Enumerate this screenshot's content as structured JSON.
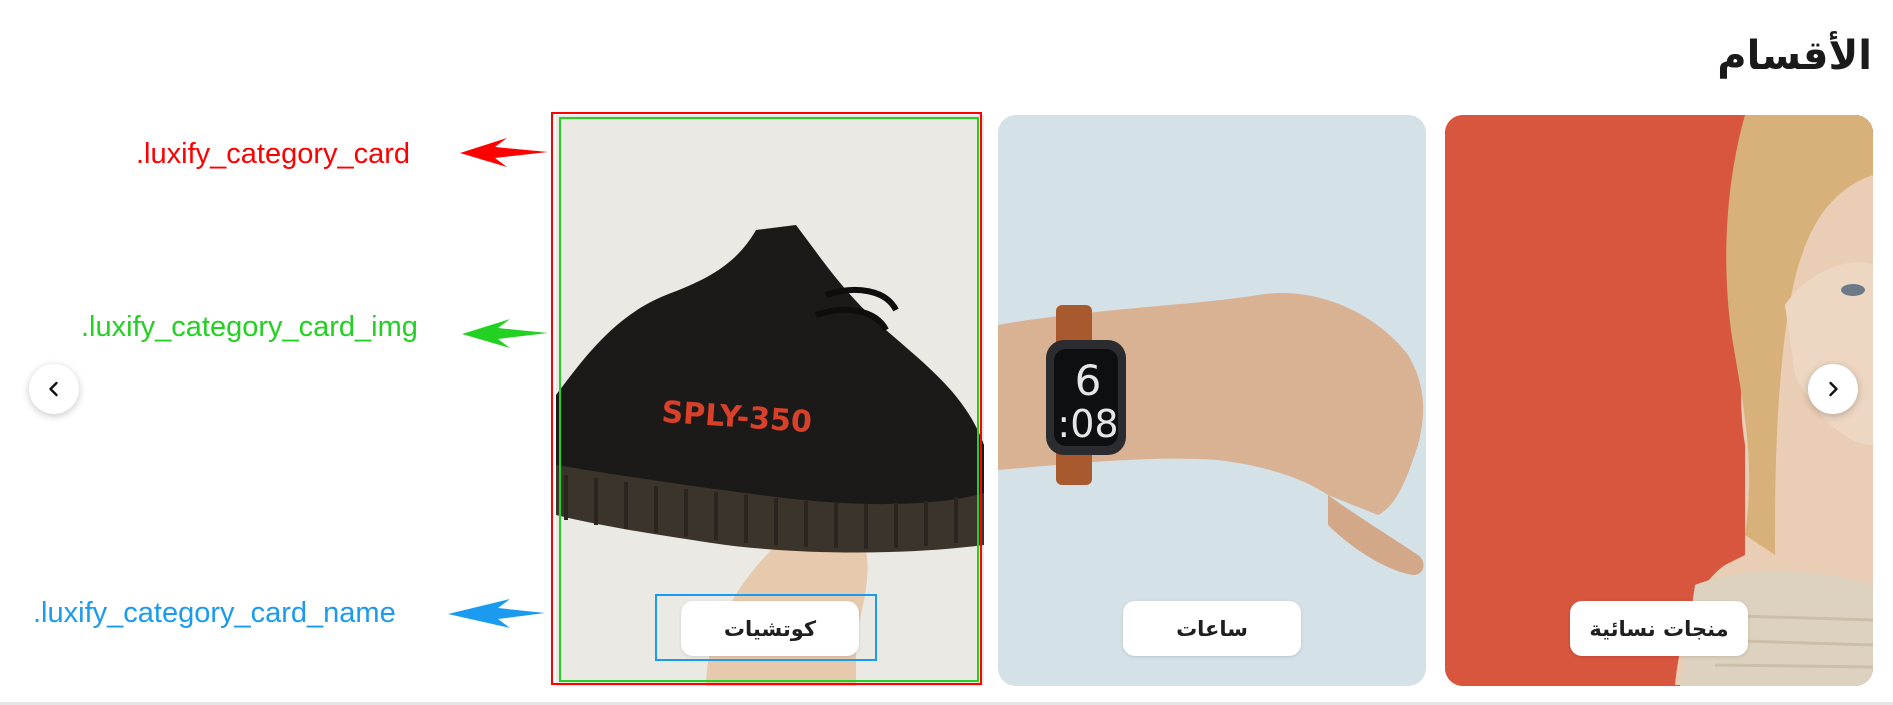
{
  "section": {
    "title": "الأقسام"
  },
  "categories": [
    {
      "name": "منجات نسائية",
      "image": "woman-portrait",
      "bg_color": "#d8553e"
    },
    {
      "name": "ساعات",
      "image": "wrist-watch",
      "bg_color": "#d4e1e7"
    },
    {
      "name": "كوتشيات",
      "image": "sneaker",
      "bg_color": "#ebe9e4"
    }
  ],
  "annotations": {
    "card": {
      "label": ".luxify_category_card",
      "color": "#ff0000"
    },
    "card_img": {
      "label": ".luxify_category_card_img",
      "color": "#22d122"
    },
    "card_name": {
      "label": ".luxify_category_card_name",
      "color": "#1a9bf0"
    }
  },
  "nav": {
    "prev_icon": "chevron-left-icon",
    "next_icon": "chevron-right-icon"
  }
}
